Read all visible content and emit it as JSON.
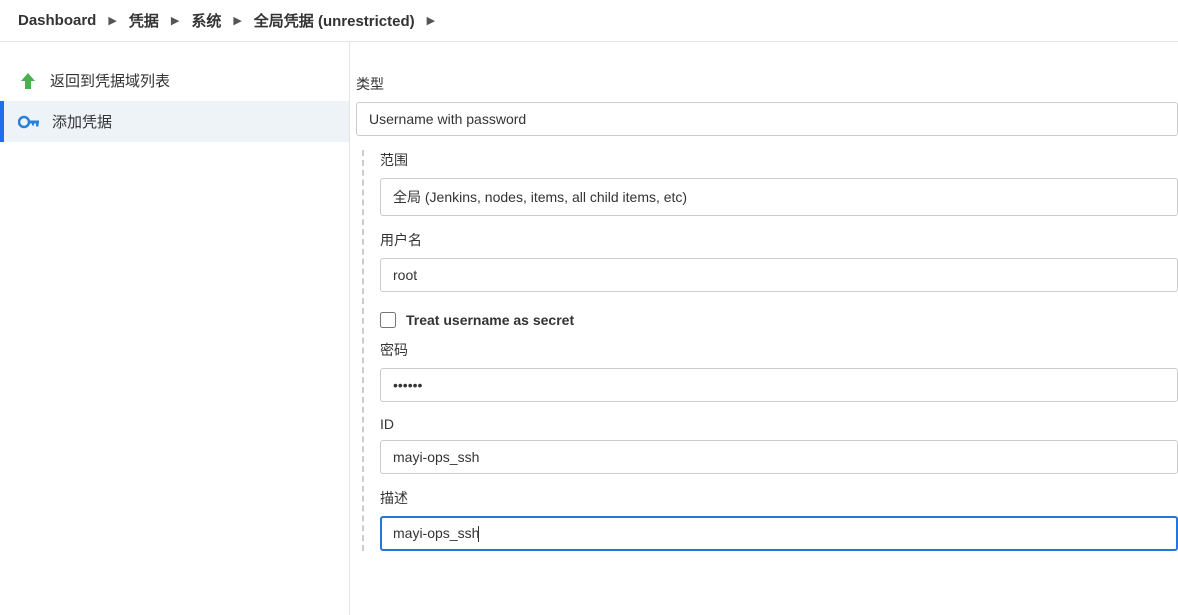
{
  "breadcrumb": {
    "items": [
      "Dashboard",
      "凭据",
      "系统",
      "全局凭据 (unrestricted)"
    ]
  },
  "sidebar": {
    "back_label": "返回到凭据域列表",
    "add_label": "添加凭据"
  },
  "form": {
    "type_label": "类型",
    "type_value": "Username with password",
    "scope_label": "范围",
    "scope_value": "全局 (Jenkins, nodes, items, all child items, etc)",
    "username_label": "用户名",
    "username_value": "root",
    "treat_secret_label": "Treat username as secret",
    "password_label": "密码",
    "password_value": "••••••",
    "id_label": "ID",
    "id_value": "mayi-ops_ssh",
    "description_label": "描述",
    "description_value": "mayi-ops_ssh"
  }
}
